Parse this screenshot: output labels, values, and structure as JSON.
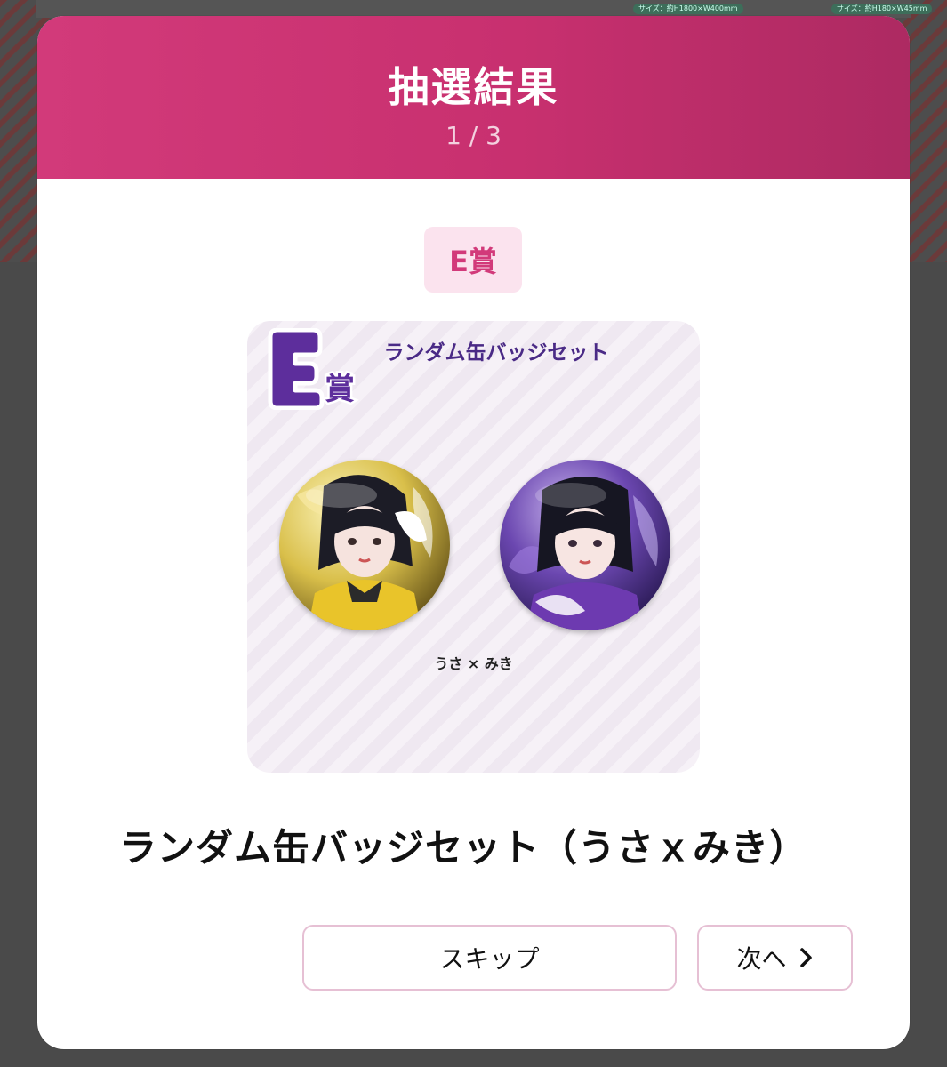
{
  "backdrop": {
    "chip_1": "サイズ：約H1800×W400mm",
    "chip_2": "サイズ：約H180×W45mm"
  },
  "modal": {
    "title": "抽選結果",
    "counter": "1 / 3"
  },
  "prize": {
    "rank_label": "E賞",
    "card_title": "ランダム缶バッジセット",
    "card_caption": "うさ × みき",
    "product_name": "ランダム缶バッジセット（うさｘみき）"
  },
  "actions": {
    "skip_label": "スキップ",
    "next_label": "次へ"
  },
  "colors": {
    "header": "#d23a7a",
    "badge_bg": "#fbe3ee",
    "button_border": "#e6c0d4",
    "card_title": "#4a2a86"
  },
  "icons": {
    "next": "chevron-right-icon"
  }
}
